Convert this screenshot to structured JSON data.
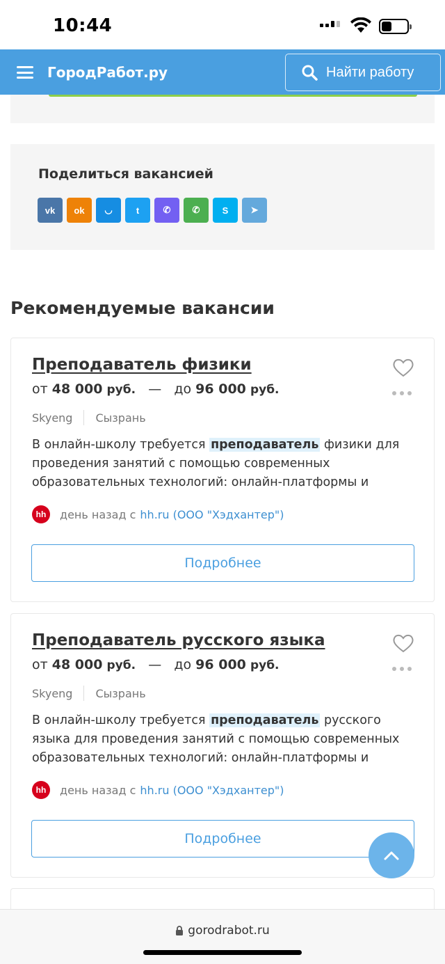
{
  "status_bar": {
    "time": "10:44"
  },
  "header": {
    "brand": "ГородРабот.ру",
    "search_button": "Найти работу",
    "accent_color": "#4a9fe0"
  },
  "share": {
    "title": "Поделиться вакансией",
    "networks": [
      {
        "name": "vk-icon",
        "glyph": "vk",
        "color": "#4a76a8"
      },
      {
        "name": "odnoklassniki-icon",
        "glyph": "ok",
        "color": "#ee8208"
      },
      {
        "name": "moimir-icon",
        "glyph": "◡",
        "color": "#168de2"
      },
      {
        "name": "twitter-icon",
        "glyph": "t",
        "color": "#1da1f2"
      },
      {
        "name": "viber-icon",
        "glyph": "✆",
        "color": "#7360f2"
      },
      {
        "name": "whatsapp-icon",
        "glyph": "✆",
        "color": "#4caf50"
      },
      {
        "name": "skype-icon",
        "glyph": "S",
        "color": "#00aff0"
      },
      {
        "name": "telegram-icon",
        "glyph": "➤",
        "color": "#64a9dc"
      }
    ]
  },
  "recommended": {
    "title": "Рекомендуемые вакансии",
    "jobs": [
      {
        "title": "Преподаватель физики",
        "salary_from_prefix": "от",
        "salary_from": "48 000",
        "salary_unit": "руб.",
        "salary_dash": "—",
        "salary_to_prefix": "до",
        "salary_to": "96 000",
        "company": "Skyeng",
        "city": "Сызрань",
        "desc_before": "В онлайн-школу требуется",
        "desc_highlight": "преподаватель",
        "desc_after": "физики для проведения занятий с помощью современных образовательных технологий: онлайн-платформы и",
        "source_logo": "hh",
        "source_time": "день назад с",
        "source_link": "hh.ru (ООО \"Хэдхантер\")",
        "more_button": "Подробнее"
      },
      {
        "title": "Преподаватель русского языка",
        "salary_from_prefix": "от",
        "salary_from": "48 000",
        "salary_unit": "руб.",
        "salary_dash": "—",
        "salary_to_prefix": "до",
        "salary_to": "96 000",
        "company": "Skyeng",
        "city": "Сызрань",
        "desc_before": "В онлайн-школу требуется",
        "desc_highlight": "преподаватель",
        "desc_after": "русского языка для проведения занятий с помощью современных образовательных технологий: онлайн-платформы и",
        "source_logo": "hh",
        "source_time": "день назад с",
        "source_link": "hh.ru (ООО \"Хэдхантер\")",
        "more_button": "Подробнее"
      }
    ]
  },
  "browser": {
    "url": "gorodrabot.ru"
  }
}
